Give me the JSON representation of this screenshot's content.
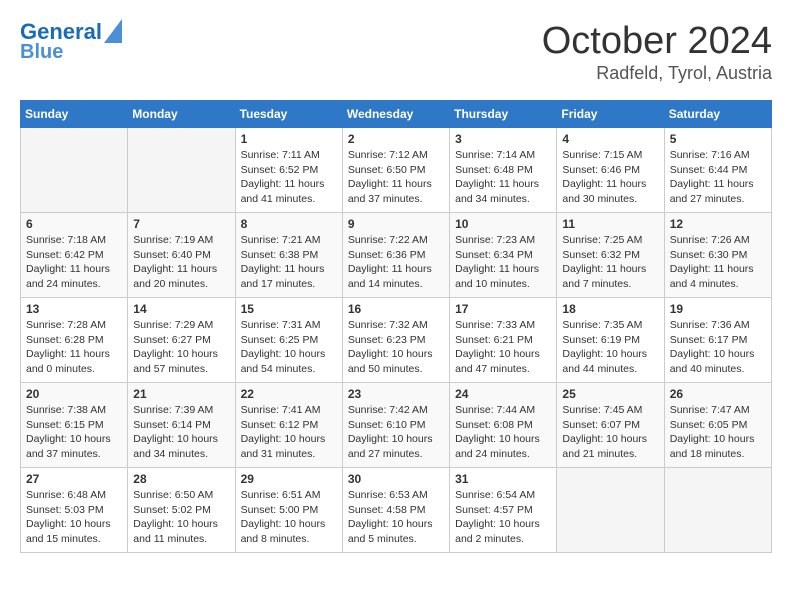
{
  "header": {
    "logo_line1": "General",
    "logo_line2": "Blue",
    "month": "October 2024",
    "location": "Radfeld, Tyrol, Austria"
  },
  "weekdays": [
    "Sunday",
    "Monday",
    "Tuesday",
    "Wednesday",
    "Thursday",
    "Friday",
    "Saturday"
  ],
  "weeks": [
    [
      {
        "day": "",
        "info": ""
      },
      {
        "day": "",
        "info": ""
      },
      {
        "day": "1",
        "info": "Sunrise: 7:11 AM\nSunset: 6:52 PM\nDaylight: 11 hours and 41 minutes."
      },
      {
        "day": "2",
        "info": "Sunrise: 7:12 AM\nSunset: 6:50 PM\nDaylight: 11 hours and 37 minutes."
      },
      {
        "day": "3",
        "info": "Sunrise: 7:14 AM\nSunset: 6:48 PM\nDaylight: 11 hours and 34 minutes."
      },
      {
        "day": "4",
        "info": "Sunrise: 7:15 AM\nSunset: 6:46 PM\nDaylight: 11 hours and 30 minutes."
      },
      {
        "day": "5",
        "info": "Sunrise: 7:16 AM\nSunset: 6:44 PM\nDaylight: 11 hours and 27 minutes."
      }
    ],
    [
      {
        "day": "6",
        "info": "Sunrise: 7:18 AM\nSunset: 6:42 PM\nDaylight: 11 hours and 24 minutes."
      },
      {
        "day": "7",
        "info": "Sunrise: 7:19 AM\nSunset: 6:40 PM\nDaylight: 11 hours and 20 minutes."
      },
      {
        "day": "8",
        "info": "Sunrise: 7:21 AM\nSunset: 6:38 PM\nDaylight: 11 hours and 17 minutes."
      },
      {
        "day": "9",
        "info": "Sunrise: 7:22 AM\nSunset: 6:36 PM\nDaylight: 11 hours and 14 minutes."
      },
      {
        "day": "10",
        "info": "Sunrise: 7:23 AM\nSunset: 6:34 PM\nDaylight: 11 hours and 10 minutes."
      },
      {
        "day": "11",
        "info": "Sunrise: 7:25 AM\nSunset: 6:32 PM\nDaylight: 11 hours and 7 minutes."
      },
      {
        "day": "12",
        "info": "Sunrise: 7:26 AM\nSunset: 6:30 PM\nDaylight: 11 hours and 4 minutes."
      }
    ],
    [
      {
        "day": "13",
        "info": "Sunrise: 7:28 AM\nSunset: 6:28 PM\nDaylight: 11 hours and 0 minutes."
      },
      {
        "day": "14",
        "info": "Sunrise: 7:29 AM\nSunset: 6:27 PM\nDaylight: 10 hours and 57 minutes."
      },
      {
        "day": "15",
        "info": "Sunrise: 7:31 AM\nSunset: 6:25 PM\nDaylight: 10 hours and 54 minutes."
      },
      {
        "day": "16",
        "info": "Sunrise: 7:32 AM\nSunset: 6:23 PM\nDaylight: 10 hours and 50 minutes."
      },
      {
        "day": "17",
        "info": "Sunrise: 7:33 AM\nSunset: 6:21 PM\nDaylight: 10 hours and 47 minutes."
      },
      {
        "day": "18",
        "info": "Sunrise: 7:35 AM\nSunset: 6:19 PM\nDaylight: 10 hours and 44 minutes."
      },
      {
        "day": "19",
        "info": "Sunrise: 7:36 AM\nSunset: 6:17 PM\nDaylight: 10 hours and 40 minutes."
      }
    ],
    [
      {
        "day": "20",
        "info": "Sunrise: 7:38 AM\nSunset: 6:15 PM\nDaylight: 10 hours and 37 minutes."
      },
      {
        "day": "21",
        "info": "Sunrise: 7:39 AM\nSunset: 6:14 PM\nDaylight: 10 hours and 34 minutes."
      },
      {
        "day": "22",
        "info": "Sunrise: 7:41 AM\nSunset: 6:12 PM\nDaylight: 10 hours and 31 minutes."
      },
      {
        "day": "23",
        "info": "Sunrise: 7:42 AM\nSunset: 6:10 PM\nDaylight: 10 hours and 27 minutes."
      },
      {
        "day": "24",
        "info": "Sunrise: 7:44 AM\nSunset: 6:08 PM\nDaylight: 10 hours and 24 minutes."
      },
      {
        "day": "25",
        "info": "Sunrise: 7:45 AM\nSunset: 6:07 PM\nDaylight: 10 hours and 21 minutes."
      },
      {
        "day": "26",
        "info": "Sunrise: 7:47 AM\nSunset: 6:05 PM\nDaylight: 10 hours and 18 minutes."
      }
    ],
    [
      {
        "day": "27",
        "info": "Sunrise: 6:48 AM\nSunset: 5:03 PM\nDaylight: 10 hours and 15 minutes."
      },
      {
        "day": "28",
        "info": "Sunrise: 6:50 AM\nSunset: 5:02 PM\nDaylight: 10 hours and 11 minutes."
      },
      {
        "day": "29",
        "info": "Sunrise: 6:51 AM\nSunset: 5:00 PM\nDaylight: 10 hours and 8 minutes."
      },
      {
        "day": "30",
        "info": "Sunrise: 6:53 AM\nSunset: 4:58 PM\nDaylight: 10 hours and 5 minutes."
      },
      {
        "day": "31",
        "info": "Sunrise: 6:54 AM\nSunset: 4:57 PM\nDaylight: 10 hours and 2 minutes."
      },
      {
        "day": "",
        "info": ""
      },
      {
        "day": "",
        "info": ""
      }
    ]
  ]
}
